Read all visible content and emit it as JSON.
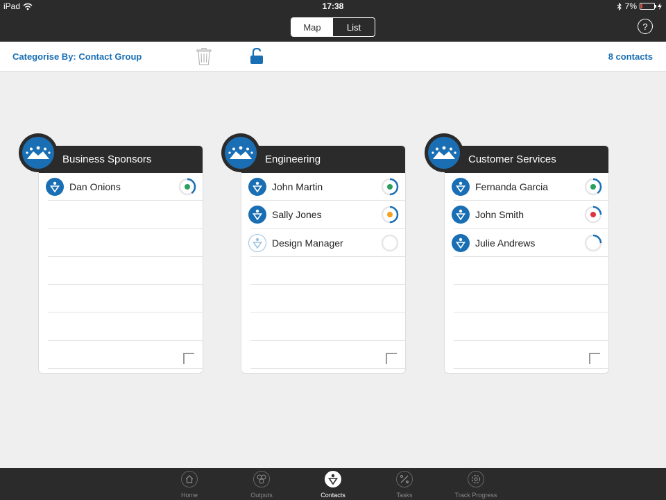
{
  "status_bar": {
    "device": "iPad",
    "time": "17:38",
    "battery": "7%"
  },
  "nav": {
    "segments": [
      {
        "label": "Map",
        "active": true
      },
      {
        "label": "List",
        "active": false
      }
    ],
    "help_label": "?"
  },
  "toolbar": {
    "categorise_label": "Categorise By: Contact Group",
    "contact_count": "8 contacts"
  },
  "colors": {
    "accent": "#1a6fb4",
    "dark": "#2b2b2b",
    "status_green": "#2aa05a",
    "status_orange": "#f4a020",
    "status_red": "#e0333a"
  },
  "groups": [
    {
      "title": "Business Sponsors",
      "contacts": [
        {
          "name": "Dan Onions",
          "status": "green",
          "progress": 0.4,
          "avatar": "filled"
        }
      ]
    },
    {
      "title": "Engineering",
      "contacts": [
        {
          "name": "John Martin",
          "status": "green",
          "progress": 0.5,
          "avatar": "filled"
        },
        {
          "name": "Sally Jones",
          "status": "orange",
          "progress": 0.5,
          "avatar": "filled"
        },
        {
          "name": "Design Manager",
          "status": "none",
          "progress": 0.0,
          "avatar": "outline"
        }
      ]
    },
    {
      "title": "Customer Services",
      "contacts": [
        {
          "name": "Fernanda Garcia",
          "status": "green",
          "progress": 0.4,
          "avatar": "filled"
        },
        {
          "name": "John Smith",
          "status": "red",
          "progress": 0.25,
          "avatar": "filled"
        },
        {
          "name": "Julie Andrews",
          "status": "none",
          "progress": 0.25,
          "avatar": "filled"
        }
      ]
    }
  ],
  "tabs": [
    {
      "label": "Home",
      "icon": "home-icon",
      "active": false
    },
    {
      "label": "Outputs",
      "icon": "outputs-icon",
      "active": false
    },
    {
      "label": "Contacts",
      "icon": "contacts-icon",
      "active": true
    },
    {
      "label": "Tasks",
      "icon": "tasks-icon",
      "active": false
    },
    {
      "label": "Track Progress",
      "icon": "track-progress-icon",
      "active": false
    }
  ]
}
